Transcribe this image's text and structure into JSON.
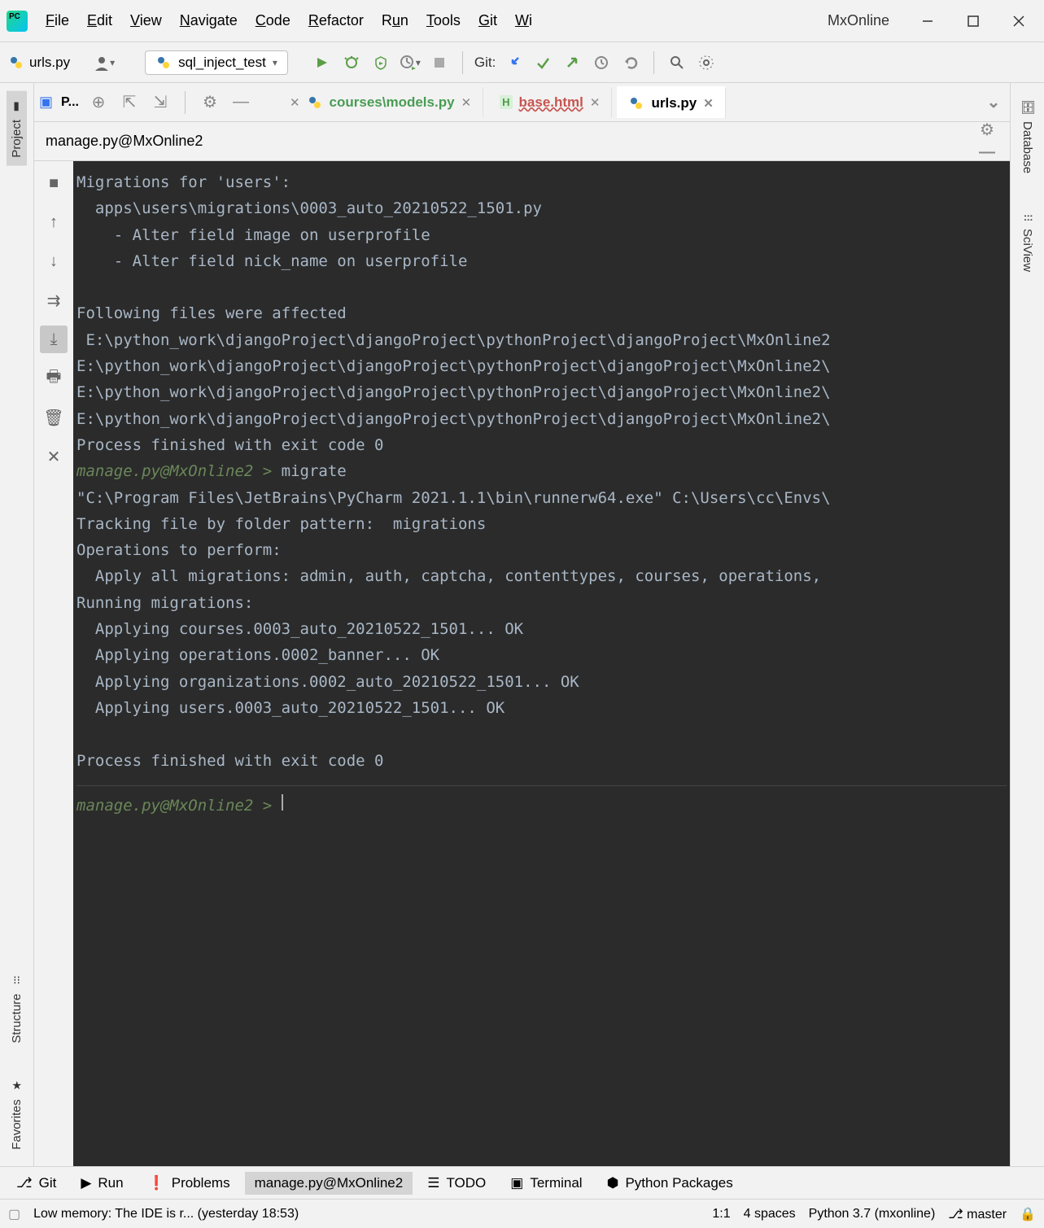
{
  "menubar": {
    "file": "File",
    "edit": "Edit",
    "view": "View",
    "navigate": "Navigate",
    "code": "Code",
    "refactor": "Refactor",
    "run": "Run",
    "tools": "Tools",
    "git": "Git",
    "window": "Wi"
  },
  "project_name": "MxOnline",
  "toolbar": {
    "crumb_file": "urls.py",
    "run_config": "sql_inject_test",
    "git_label": "Git:"
  },
  "editor_tabs": {
    "project_toggle": "P...",
    "tab1": "courses\\models.py",
    "tab2": "base.html",
    "tab3": "urls.py"
  },
  "terminal": {
    "header": "manage.py@MxOnline2",
    "lines": [
      "Migrations for 'users':",
      "  apps\\users\\migrations\\0003_auto_20210522_1501.py",
      "    - Alter field image on userprofile",
      "    - Alter field nick_name on userprofile",
      "",
      "Following files were affected ",
      " E:\\python_work\\djangoProject\\djangoProject\\pythonProject\\djangoProject\\MxOnline2",
      "E:\\python_work\\djangoProject\\djangoProject\\pythonProject\\djangoProject\\MxOnline2\\",
      "E:\\python_work\\djangoProject\\djangoProject\\pythonProject\\djangoProject\\MxOnline2\\",
      "E:\\python_work\\djangoProject\\djangoProject\\pythonProject\\djangoProject\\MxOnline2\\",
      "Process finished with exit code 0"
    ],
    "prompt1": "manage.py@MxOnline2 > ",
    "cmd1": "migrate",
    "lines2": [
      "\"C:\\Program Files\\JetBrains\\PyCharm 2021.1.1\\bin\\runnerw64.exe\" C:\\Users\\cc\\Envs\\",
      "Tracking file by folder pattern:  migrations",
      "Operations to perform:",
      "  Apply all migrations: admin, auth, captcha, contenttypes, courses, operations, ",
      "Running migrations:",
      "  Applying courses.0003_auto_20210522_1501... OK",
      "  Applying operations.0002_banner... OK",
      "  Applying organizations.0002_auto_20210522_1501... OK",
      "  Applying users.0003_auto_20210522_1501... OK",
      "",
      "Process finished with exit code 0"
    ],
    "prompt2": "manage.py@MxOnline2 > "
  },
  "bottom_tabs": {
    "git": "Git",
    "run": "Run",
    "problems": "Problems",
    "manage": "manage.py@MxOnline2",
    "todo": "TODO",
    "terminal": "Terminal",
    "packages": "Python Packages"
  },
  "side": {
    "project": "Project",
    "structure": "Structure",
    "favorites": "Favorites",
    "database": "Database",
    "sciview": "SciView"
  },
  "statusbar": {
    "msg": "Low memory: The IDE is r... (yesterday 18:53)",
    "pos": "1:1",
    "indent": "4 spaces",
    "interpreter": "Python 3.7 (mxonline)",
    "branch": "master"
  }
}
